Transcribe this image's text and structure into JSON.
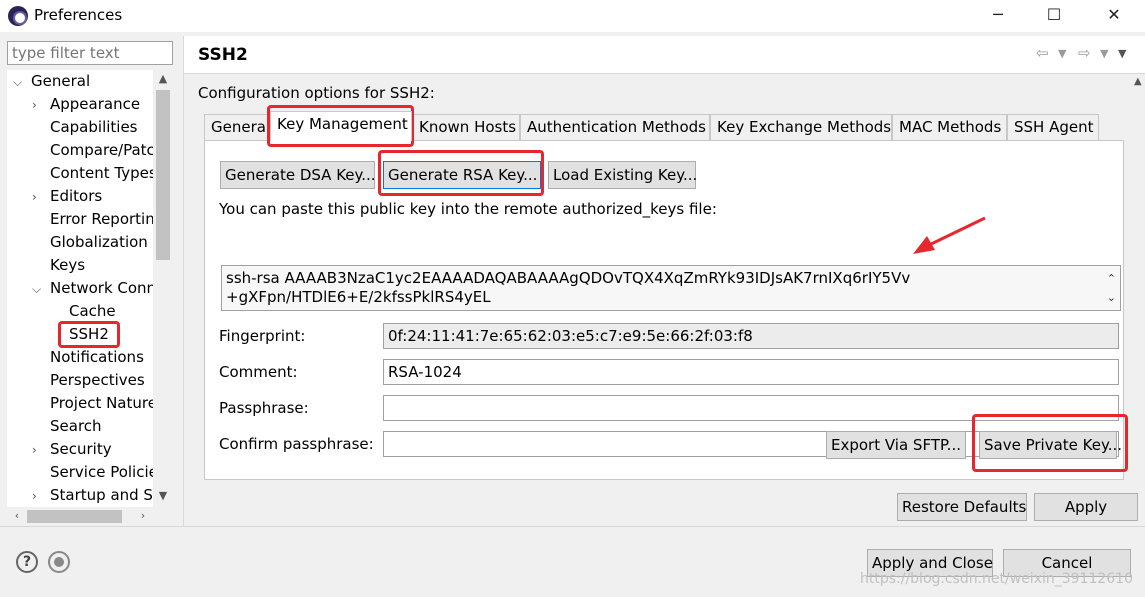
{
  "window": {
    "title": "Preferences"
  },
  "filter": {
    "placeholder": "type filter text"
  },
  "tree": [
    {
      "label": "General",
      "chevron": "⌵",
      "indent": 0
    },
    {
      "label": "Appearance",
      "chevron": "›",
      "indent": 1
    },
    {
      "label": "Capabilities",
      "chevron": "",
      "indent": 1
    },
    {
      "label": "Compare/Patc",
      "chevron": "",
      "indent": 1
    },
    {
      "label": "Content Types",
      "chevron": "",
      "indent": 1
    },
    {
      "label": "Editors",
      "chevron": "›",
      "indent": 1
    },
    {
      "label": "Error Reportin",
      "chevron": "",
      "indent": 1
    },
    {
      "label": "Globalization",
      "chevron": "",
      "indent": 1
    },
    {
      "label": "Keys",
      "chevron": "",
      "indent": 1
    },
    {
      "label": "Network Conn",
      "chevron": "⌵",
      "indent": 1
    },
    {
      "label": "Cache",
      "chevron": "",
      "indent": 2
    },
    {
      "label": "SSH2",
      "chevron": "",
      "indent": 2
    },
    {
      "label": "Notifications",
      "chevron": "",
      "indent": 1
    },
    {
      "label": "Perspectives",
      "chevron": "",
      "indent": 1
    },
    {
      "label": "Project Nature",
      "chevron": "",
      "indent": 1
    },
    {
      "label": "Search",
      "chevron": "",
      "indent": 1
    },
    {
      "label": "Security",
      "chevron": "›",
      "indent": 1
    },
    {
      "label": "Service Policie",
      "chevron": "",
      "indent": 1
    },
    {
      "label": "Startup and Sh",
      "chevron": "›",
      "indent": 1
    }
  ],
  "page": {
    "title": "SSH2",
    "config_label": "Configuration options for SSH2:"
  },
  "tabs": [
    "General",
    "Key Management",
    "Known Hosts",
    "Authentication Methods",
    "Key Exchange Methods",
    "MAC Methods",
    "SSH Agent"
  ],
  "key_mgmt": {
    "gen_dsa": "Generate DSA Key...",
    "gen_rsa": "Generate RSA Key...",
    "load_key": "Load Existing Key...",
    "paste_label": "You can paste this public key into the remote authorized_keys file:",
    "public_key_line1": "ssh-rsa AAAAB3NzaC1yc2EAAAADAQABAAAAgQDOvTQX4XqZmRYk93IDJsAK7rnIXq6rIY5Vv",
    "public_key_line2": "+gXFpn/HTDlE6+E/2kfssPklRS4yEL",
    "fingerprint_label": "Fingerprint:",
    "fingerprint": "0f:24:11:41:7e:65:62:03:e5:c7:e9:5e:66:2f:03:f8",
    "comment_label": "Comment:",
    "comment": "RSA-1024",
    "passphrase_label": "Passphrase:",
    "confirm_label": "Confirm passphrase:",
    "export_sftp": "Export Via SFTP...",
    "save_private": "Save Private Key..."
  },
  "footer": {
    "restore_defaults": "Restore Defaults",
    "apply": "Apply",
    "apply_close": "Apply and Close",
    "cancel": "Cancel",
    "watermark": "https://blog.csdn.net/weixin_39112610"
  },
  "colors": {
    "highlight": "#e6282e",
    "focus": "#0078d7"
  }
}
